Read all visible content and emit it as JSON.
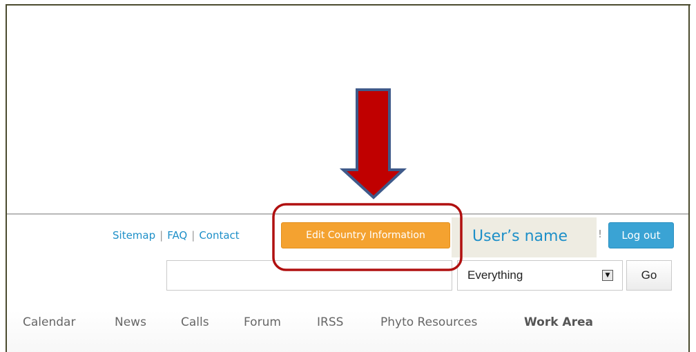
{
  "header": {
    "links": [
      "Sitemap",
      "FAQ",
      "Contact"
    ],
    "edit_button_label": "Edit Country Information",
    "user_name": "User’s name",
    "hidden_suffix": "!",
    "logout_label": "Log out"
  },
  "search": {
    "query_value": "",
    "scope_selected": "Everything",
    "go_label": "Go"
  },
  "nav": {
    "items": [
      "Calendar",
      "News",
      "Calls",
      "Forum",
      "IRSS",
      "Phyto Resources",
      "Work Area"
    ],
    "active": "Work Area"
  },
  "colors": {
    "link": "#1d8fc8",
    "edit_button": "#f4a230",
    "logout_button": "#3aa3d4",
    "annotation_arrow": "#c00000",
    "annotation_outline": "#b01010"
  }
}
